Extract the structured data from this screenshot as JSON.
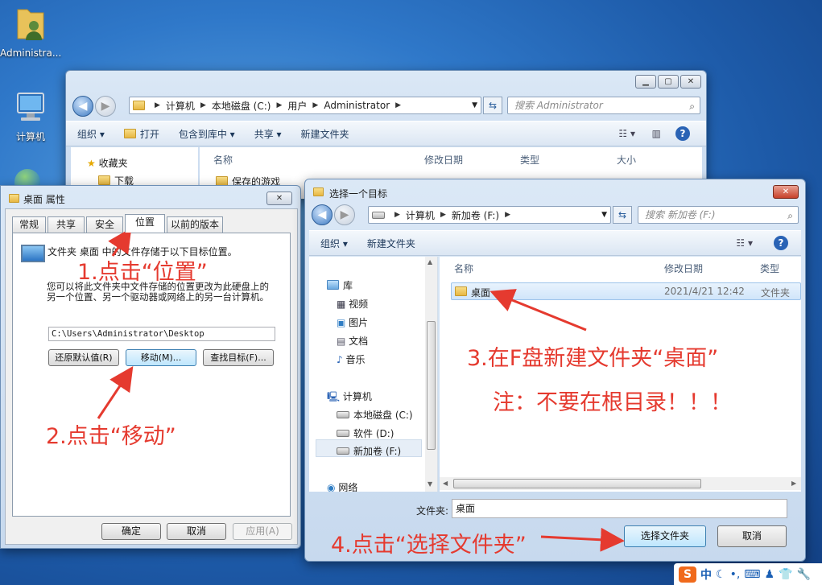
{
  "desktop": {
    "icons": [
      {
        "label": "Administra...",
        "icon": "user-folder-icon"
      },
      {
        "label": "计算机",
        "icon": "computer-icon"
      }
    ]
  },
  "explorer": {
    "address_parts": [
      "计算机",
      "本地磁盘 (C:)",
      "用户",
      "Administrator"
    ],
    "search_placeholder": "搜索 Administrator",
    "toolbar": {
      "organize": "组织 ▾",
      "open": "打开",
      "include_library": "包含到库中 ▾",
      "share": "共享 ▾",
      "new_folder": "新建文件夹"
    },
    "columns": {
      "name": "名称",
      "modified": "修改日期",
      "type": "类型",
      "size": "大小"
    },
    "nav": {
      "favorites": "收藏夹",
      "downloads": "下载"
    },
    "first_row": "保存的游戏"
  },
  "props": {
    "title": "桌面 属性",
    "tabs": [
      "常规",
      "共享",
      "安全",
      "位置",
      "以前的版本"
    ],
    "active_tab": "位置",
    "desc1": "文件夹 桌面 中的文件存储于以下目标位置。",
    "desc2": "您可以将此文件夹中文件存储的位置更改为此硬盘上的另一个位置、另一个驱动器或网络上的另一台计算机。",
    "path_value": "C:\\Users\\Administrator\\Desktop",
    "btn_restore": "还原默认值(R)",
    "btn_move": "移动(M)...",
    "btn_find": "查找目标(F)...",
    "btn_ok": "确定",
    "btn_cancel": "取消",
    "btn_apply": "应用(A)"
  },
  "picker": {
    "title": "选择一个目标",
    "address_parts": [
      "计算机",
      "新加卷 (F:)"
    ],
    "search_placeholder": "搜索 新加卷 (F:)",
    "toolbar": {
      "organize": "组织 ▾",
      "new_folder": "新建文件夹"
    },
    "columns": {
      "name": "名称",
      "modified": "修改日期",
      "type": "类型"
    },
    "nav": {
      "library": "库",
      "video": "视频",
      "pictures": "图片",
      "documents": "文档",
      "music": "音乐",
      "computer": "计算机",
      "drive_c": "本地磁盘 (C:)",
      "drive_d": "软件 (D:)",
      "drive_f": "新加卷 (F:)",
      "network": "网络"
    },
    "row": {
      "name": "桌面",
      "modified": "2021/4/21 12:42",
      "type": "文件夹"
    },
    "folder_label": "文件夹:",
    "folder_value": "桌面",
    "btn_select": "选择文件夹",
    "btn_cancel": "取消"
  },
  "annotations": {
    "step1": "1.点击“位置”",
    "step2": "2.点击“移动”",
    "step3": "3.在F盘新建文件夹“桌面”",
    "note": "注：不要在根目录！！！",
    "step4": "4.点击“选择文件夹”",
    "color": "#e53a2f"
  },
  "tray": {
    "ime": "中"
  }
}
